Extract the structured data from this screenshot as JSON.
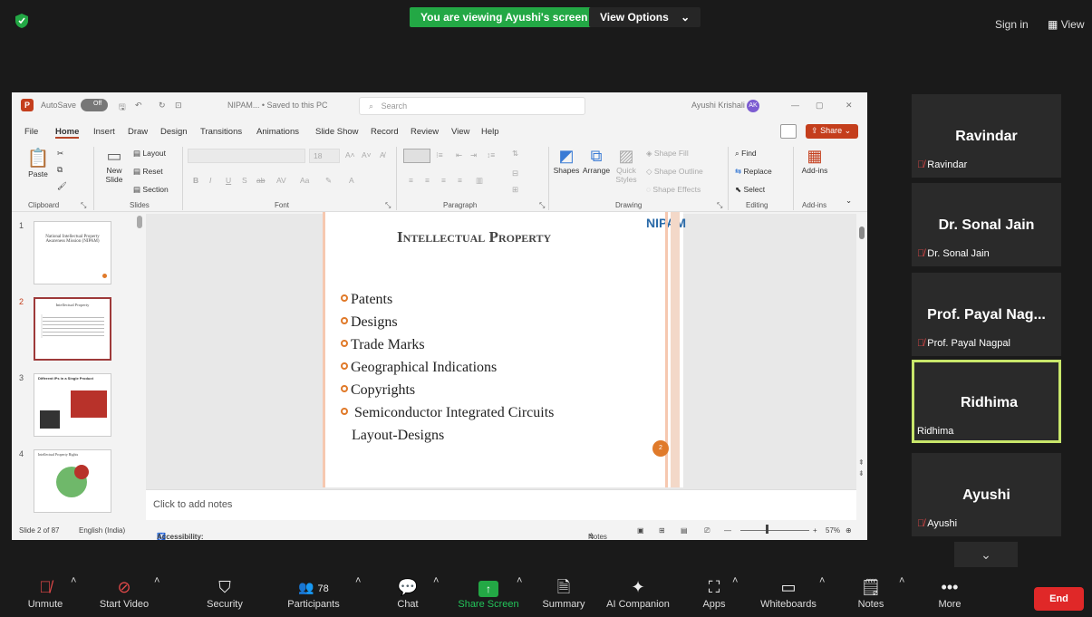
{
  "zoom_bar": {
    "banner": "You are viewing Ayushi's screen",
    "view_options": "View Options",
    "sign_in": "Sign in",
    "view": "View"
  },
  "ppt": {
    "autosave": "AutoSave",
    "autosave_state": "Off",
    "file_title": "NIPAM... • Saved to this PC",
    "search_placeholder": "Search",
    "user": "Ayushi Krishali",
    "user_initials": "AK",
    "share": "Share",
    "menu": [
      "File",
      "Home",
      "Insert",
      "Draw",
      "Design",
      "Transitions",
      "Animations",
      "Slide Show",
      "Record",
      "Review",
      "View",
      "Help"
    ],
    "ribbon": {
      "paste": "Paste",
      "clipboard": "Clipboard",
      "new_slide": "New Slide",
      "layout": "Layout",
      "reset": "Reset",
      "section": "Section",
      "slides": "Slides",
      "font": "Font",
      "font_size": "18",
      "paragraph": "Paragraph",
      "shapes": "Shapes",
      "arrange": "Arrange",
      "quick_styles": "Quick Styles",
      "shape_fill": "Shape Fill",
      "shape_outline": "Shape Outline",
      "shape_effects": "Shape Effects",
      "drawing": "Drawing",
      "find": "Find",
      "replace": "Replace",
      "select": "Select",
      "editing": "Editing",
      "addins": "Add-ins",
      "addins_group": "Add-ins"
    },
    "thumbnails": [
      {
        "num": "1",
        "text": "National Intellectual Property Awareness Mission (NIPAM)"
      },
      {
        "num": "2",
        "text": "Intellectual Property"
      },
      {
        "num": "3",
        "text": "Different IPs in a Single Product"
      },
      {
        "num": "4",
        "text": "Intellectual Property Rights"
      }
    ],
    "slide": {
      "title": "Intellectual Property",
      "logo": "NIPAM",
      "page_num": "2",
      "bullets": [
        "Patents",
        "Designs",
        "Trade Marks",
        "Geographical Indications",
        "Copyrights",
        " Semiconductor Integrated Circuits"
      ],
      "bullet_cont": "Layout-Designs"
    },
    "notes_placeholder": "Click to add notes",
    "status": {
      "slide_of": "Slide 2 of 87",
      "language": "English (India)",
      "accessibility": "Accessibility: Investigate",
      "notes": "Notes",
      "zoom": "57%"
    }
  },
  "participants": [
    {
      "name": "Ravindar",
      "label": "Ravindar",
      "muted": true
    },
    {
      "name": "Dr. Sonal Jain",
      "label": "Dr. Sonal Jain",
      "muted": true
    },
    {
      "name": "Prof. Payal Nag...",
      "label": "Prof. Payal Nagpal",
      "muted": true
    },
    {
      "name": "Ridhima",
      "label": "Ridhima",
      "muted": false
    },
    {
      "name": "Ayushi",
      "label": "Ayushi",
      "muted": true
    }
  ],
  "toolbar": {
    "unmute": "Unmute",
    "start_video": "Start Video",
    "security": "Security",
    "participants": "Participants",
    "participants_count": "78",
    "chat": "Chat",
    "share_screen": "Share Screen",
    "summary": "Summary",
    "ai_companion": "AI Companion",
    "apps": "Apps",
    "whiteboards": "Whiteboards",
    "notes": "Notes",
    "more": "More",
    "end": "End"
  },
  "colors": {
    "banner_green": "#23a845",
    "end_red": "#e02828",
    "active_speaker": "#c8e66a",
    "ppt_accent": "#b7472a",
    "bullet_orange": "#e07a2a"
  }
}
